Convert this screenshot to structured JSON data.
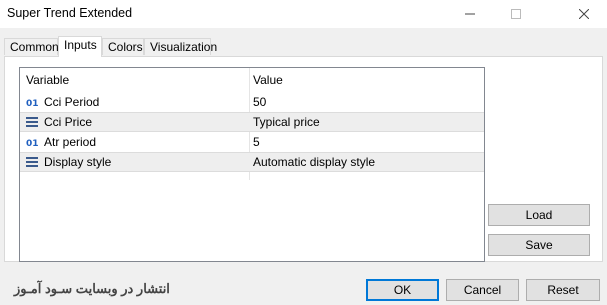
{
  "window": {
    "title": "Super Trend Extended"
  },
  "tabs": [
    {
      "label": "Common"
    },
    {
      "label": "Inputs"
    },
    {
      "label": "Colors"
    },
    {
      "label": "Visualization"
    }
  ],
  "grid": {
    "headers": {
      "variable": "Variable",
      "value": "Value"
    },
    "rows": [
      {
        "icon": "integer-icon",
        "variable": "Cci Period",
        "value": "50"
      },
      {
        "icon": "enum-icon",
        "variable": "Cci Price",
        "value": "Typical price"
      },
      {
        "icon": "integer-icon",
        "variable": "Atr period",
        "value": "5"
      },
      {
        "icon": "enum-icon",
        "variable": "Display style",
        "value": "Automatic display style"
      }
    ]
  },
  "side_buttons": {
    "load": "Load",
    "save": "Save"
  },
  "footer": {
    "watermark": "انتشار در وبسایت سـود آمـوز",
    "ok": "OK",
    "cancel": "Cancel",
    "reset": "Reset"
  },
  "colors": {
    "accent": "#0078d7",
    "int_icon": "#1f5fbf"
  }
}
